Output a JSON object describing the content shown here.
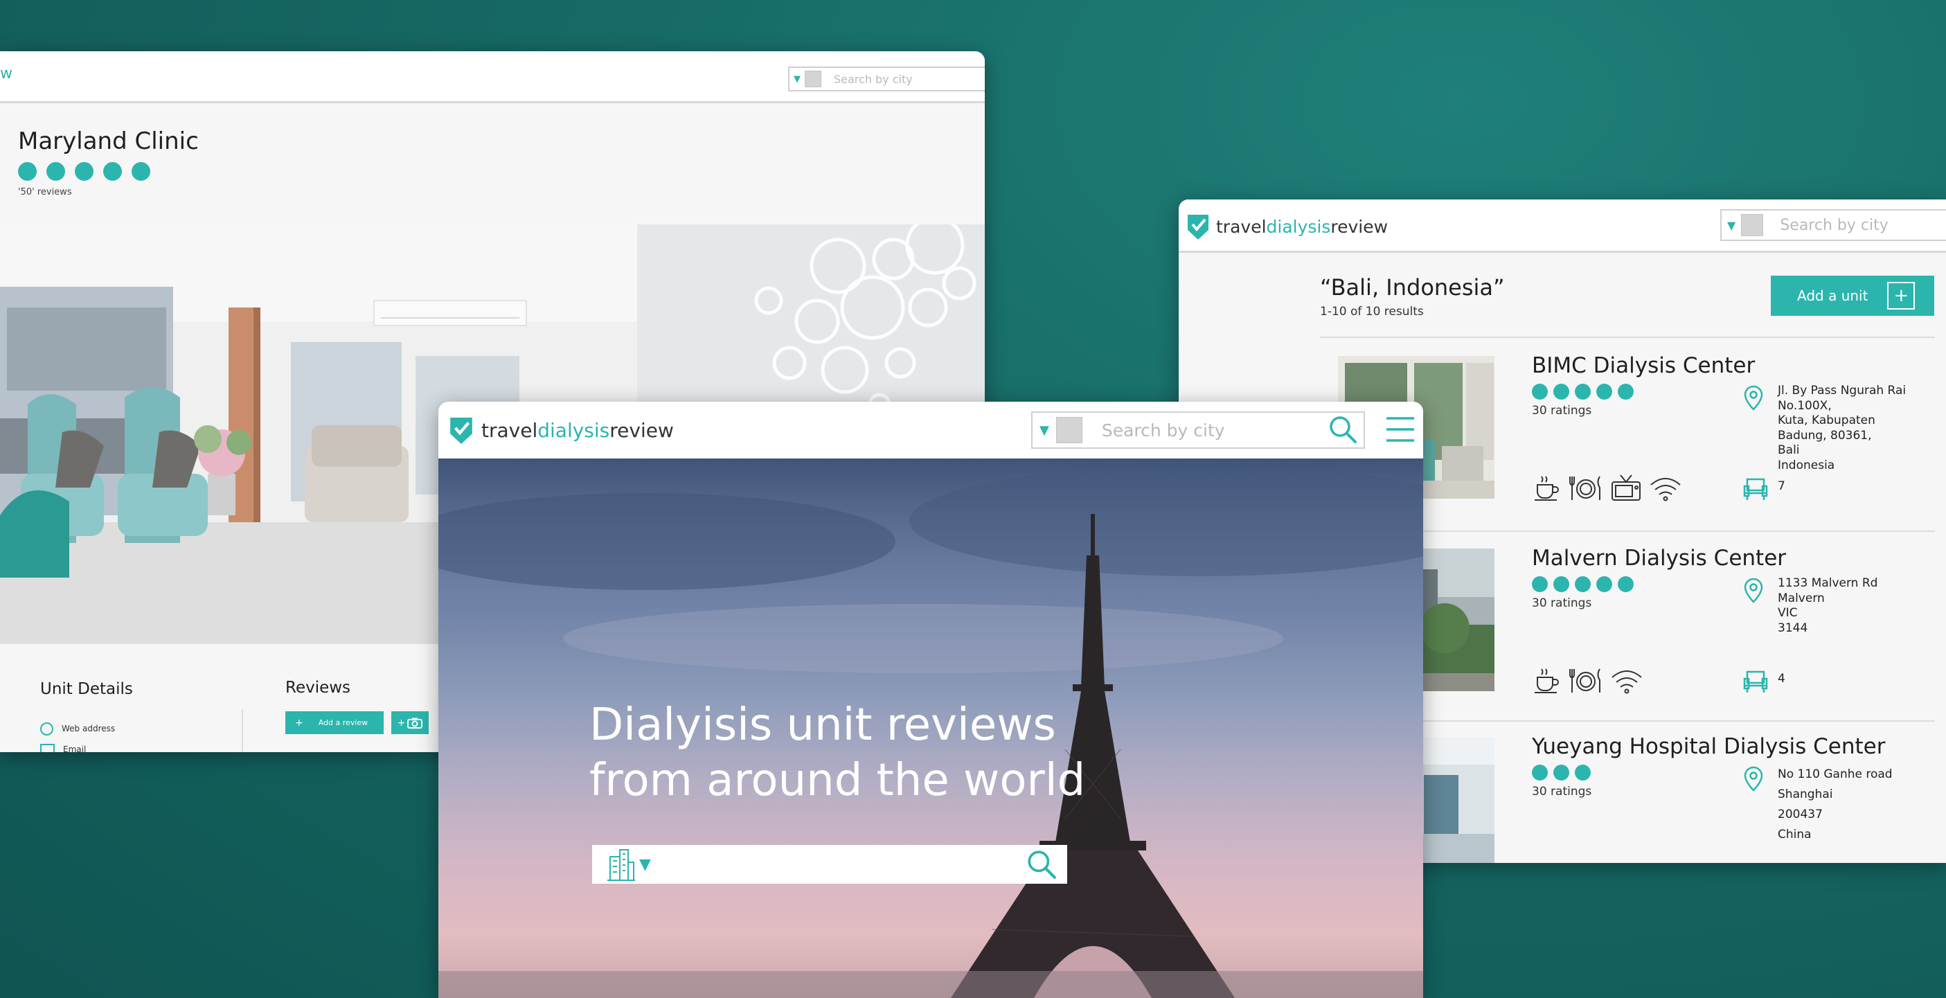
{
  "clinic_window": {
    "logo_fragment": "w",
    "search_placeholder": "Search by city",
    "clinic_name": "Maryland Clinic",
    "rating_dots": 5,
    "reviews_count": "'50' reviews",
    "unit_details_heading": "Unit Details",
    "details": [
      "Web address",
      "Email"
    ],
    "reviews_heading": "Reviews",
    "add_review_label": "Add a review",
    "add_review_plus": "+",
    "add_photo_plus": "+"
  },
  "results_window": {
    "logo": {
      "part1": "travel",
      "part2": "dialysis",
      "part3": "review"
    },
    "search_placeholder": "Search by city",
    "query_title": "“Bali, Indonesia”",
    "results_count": "1-10 of 10 results",
    "add_unit_label": "Add a unit",
    "add_unit_plus": "+",
    "results": [
      {
        "name": "BIMC Dialysis Center",
        "rating_dots": 5,
        "ratings_text": "30 ratings",
        "address": [
          "Jl. By Pass Ngurah Rai",
          "No.100X,",
          "Kuta, Kabupaten",
          "Badung, 80361,",
          "Bali",
          "Indonesia"
        ],
        "chairs": "7",
        "amenities": [
          "coffee-icon",
          "meal-icon",
          "tv-icon",
          "wifi-icon"
        ]
      },
      {
        "name": "Malvern Dialysis Center",
        "rating_dots": 5,
        "ratings_text": "30 ratings",
        "address": [
          "1133 Malvern Rd",
          "Malvern",
          "VIC",
          "3144"
        ],
        "chairs": "4",
        "amenities": [
          "coffee-icon",
          "meal-icon",
          "wifi-icon"
        ]
      },
      {
        "name": "Yueyang Hospital Dialysis Center",
        "rating_dots": 3,
        "ratings_text": "30 ratings",
        "address": [
          "No 110 Ganhe road",
          "Shanghai",
          "200437",
          "China"
        ],
        "chairs": "",
        "amenities": []
      }
    ]
  },
  "home_window": {
    "logo": {
      "part1": "travel",
      "part2": "dialysis",
      "part3": "review"
    },
    "search_placeholder": "Search by city",
    "hero_line1": "Dialyisis unit reviews",
    "hero_line2": "from around the world"
  },
  "colors": {
    "accent": "#2bb5ad",
    "background": "#176a66",
    "panel": "#f6f6f6"
  }
}
